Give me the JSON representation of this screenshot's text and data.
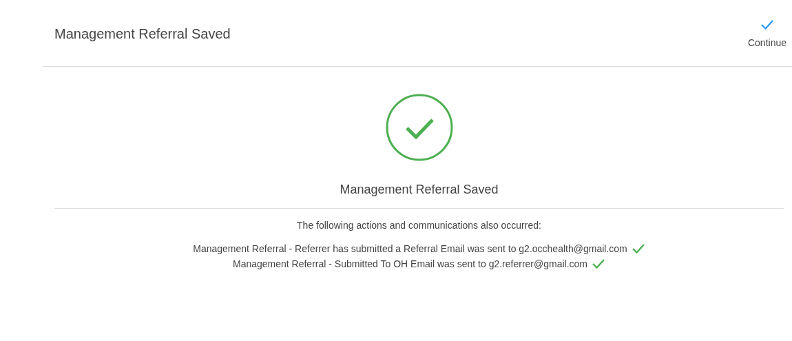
{
  "header": {
    "title": "Management Referral Saved",
    "continue_button": "Continue"
  },
  "result": {
    "success": true,
    "message": "Management Referral Saved"
  },
  "actions_intro": "The following actions and communications also occurred:",
  "actions": [
    {
      "text": "Management Referral - Referrer has submitted a Referral Email was sent to g2.occhealth@gmail.com",
      "done": true
    },
    {
      "text": "Management Referral - Submitted To OH Email was sent to g2.referrer@gmail.com",
      "done": true
    }
  ]
}
